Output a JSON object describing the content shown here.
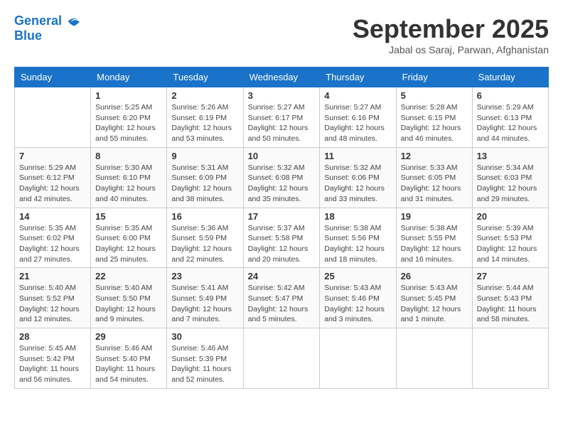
{
  "header": {
    "logo_line1": "General",
    "logo_line2": "Blue",
    "month": "September 2025",
    "location": "Jabal os Saraj, Parwan, Afghanistan"
  },
  "days_of_week": [
    "Sunday",
    "Monday",
    "Tuesday",
    "Wednesday",
    "Thursday",
    "Friday",
    "Saturday"
  ],
  "weeks": [
    [
      {
        "day": "",
        "sunrise": "",
        "sunset": "",
        "daylight": ""
      },
      {
        "day": "1",
        "sunrise": "Sunrise: 5:25 AM",
        "sunset": "Sunset: 6:20 PM",
        "daylight": "Daylight: 12 hours and 55 minutes."
      },
      {
        "day": "2",
        "sunrise": "Sunrise: 5:26 AM",
        "sunset": "Sunset: 6:19 PM",
        "daylight": "Daylight: 12 hours and 53 minutes."
      },
      {
        "day": "3",
        "sunrise": "Sunrise: 5:27 AM",
        "sunset": "Sunset: 6:17 PM",
        "daylight": "Daylight: 12 hours and 50 minutes."
      },
      {
        "day": "4",
        "sunrise": "Sunrise: 5:27 AM",
        "sunset": "Sunset: 6:16 PM",
        "daylight": "Daylight: 12 hours and 48 minutes."
      },
      {
        "day": "5",
        "sunrise": "Sunrise: 5:28 AM",
        "sunset": "Sunset: 6:15 PM",
        "daylight": "Daylight: 12 hours and 46 minutes."
      },
      {
        "day": "6",
        "sunrise": "Sunrise: 5:29 AM",
        "sunset": "Sunset: 6:13 PM",
        "daylight": "Daylight: 12 hours and 44 minutes."
      }
    ],
    [
      {
        "day": "7",
        "sunrise": "Sunrise: 5:29 AM",
        "sunset": "Sunset: 6:12 PM",
        "daylight": "Daylight: 12 hours and 42 minutes."
      },
      {
        "day": "8",
        "sunrise": "Sunrise: 5:30 AM",
        "sunset": "Sunset: 6:10 PM",
        "daylight": "Daylight: 12 hours and 40 minutes."
      },
      {
        "day": "9",
        "sunrise": "Sunrise: 5:31 AM",
        "sunset": "Sunset: 6:09 PM",
        "daylight": "Daylight: 12 hours and 38 minutes."
      },
      {
        "day": "10",
        "sunrise": "Sunrise: 5:32 AM",
        "sunset": "Sunset: 6:08 PM",
        "daylight": "Daylight: 12 hours and 35 minutes."
      },
      {
        "day": "11",
        "sunrise": "Sunrise: 5:32 AM",
        "sunset": "Sunset: 6:06 PM",
        "daylight": "Daylight: 12 hours and 33 minutes."
      },
      {
        "day": "12",
        "sunrise": "Sunrise: 5:33 AM",
        "sunset": "Sunset: 6:05 PM",
        "daylight": "Daylight: 12 hours and 31 minutes."
      },
      {
        "day": "13",
        "sunrise": "Sunrise: 5:34 AM",
        "sunset": "Sunset: 6:03 PM",
        "daylight": "Daylight: 12 hours and 29 minutes."
      }
    ],
    [
      {
        "day": "14",
        "sunrise": "Sunrise: 5:35 AM",
        "sunset": "Sunset: 6:02 PM",
        "daylight": "Daylight: 12 hours and 27 minutes."
      },
      {
        "day": "15",
        "sunrise": "Sunrise: 5:35 AM",
        "sunset": "Sunset: 6:00 PM",
        "daylight": "Daylight: 12 hours and 25 minutes."
      },
      {
        "day": "16",
        "sunrise": "Sunrise: 5:36 AM",
        "sunset": "Sunset: 5:59 PM",
        "daylight": "Daylight: 12 hours and 22 minutes."
      },
      {
        "day": "17",
        "sunrise": "Sunrise: 5:37 AM",
        "sunset": "Sunset: 5:58 PM",
        "daylight": "Daylight: 12 hours and 20 minutes."
      },
      {
        "day": "18",
        "sunrise": "Sunrise: 5:38 AM",
        "sunset": "Sunset: 5:56 PM",
        "daylight": "Daylight: 12 hours and 18 minutes."
      },
      {
        "day": "19",
        "sunrise": "Sunrise: 5:38 AM",
        "sunset": "Sunset: 5:55 PM",
        "daylight": "Daylight: 12 hours and 16 minutes."
      },
      {
        "day": "20",
        "sunrise": "Sunrise: 5:39 AM",
        "sunset": "Sunset: 5:53 PM",
        "daylight": "Daylight: 12 hours and 14 minutes."
      }
    ],
    [
      {
        "day": "21",
        "sunrise": "Sunrise: 5:40 AM",
        "sunset": "Sunset: 5:52 PM",
        "daylight": "Daylight: 12 hours and 12 minutes."
      },
      {
        "day": "22",
        "sunrise": "Sunrise: 5:40 AM",
        "sunset": "Sunset: 5:50 PM",
        "daylight": "Daylight: 12 hours and 9 minutes."
      },
      {
        "day": "23",
        "sunrise": "Sunrise: 5:41 AM",
        "sunset": "Sunset: 5:49 PM",
        "daylight": "Daylight: 12 hours and 7 minutes."
      },
      {
        "day": "24",
        "sunrise": "Sunrise: 5:42 AM",
        "sunset": "Sunset: 5:47 PM",
        "daylight": "Daylight: 12 hours and 5 minutes."
      },
      {
        "day": "25",
        "sunrise": "Sunrise: 5:43 AM",
        "sunset": "Sunset: 5:46 PM",
        "daylight": "Daylight: 12 hours and 3 minutes."
      },
      {
        "day": "26",
        "sunrise": "Sunrise: 5:43 AM",
        "sunset": "Sunset: 5:45 PM",
        "daylight": "Daylight: 12 hours and 1 minute."
      },
      {
        "day": "27",
        "sunrise": "Sunrise: 5:44 AM",
        "sunset": "Sunset: 5:43 PM",
        "daylight": "Daylight: 11 hours and 58 minutes."
      }
    ],
    [
      {
        "day": "28",
        "sunrise": "Sunrise: 5:45 AM",
        "sunset": "Sunset: 5:42 PM",
        "daylight": "Daylight: 11 hours and 56 minutes."
      },
      {
        "day": "29",
        "sunrise": "Sunrise: 5:46 AM",
        "sunset": "Sunset: 5:40 PM",
        "daylight": "Daylight: 11 hours and 54 minutes."
      },
      {
        "day": "30",
        "sunrise": "Sunrise: 5:46 AM",
        "sunset": "Sunset: 5:39 PM",
        "daylight": "Daylight: 11 hours and 52 minutes."
      },
      {
        "day": "",
        "sunrise": "",
        "sunset": "",
        "daylight": ""
      },
      {
        "day": "",
        "sunrise": "",
        "sunset": "",
        "daylight": ""
      },
      {
        "day": "",
        "sunrise": "",
        "sunset": "",
        "daylight": ""
      },
      {
        "day": "",
        "sunrise": "",
        "sunset": "",
        "daylight": ""
      }
    ]
  ]
}
